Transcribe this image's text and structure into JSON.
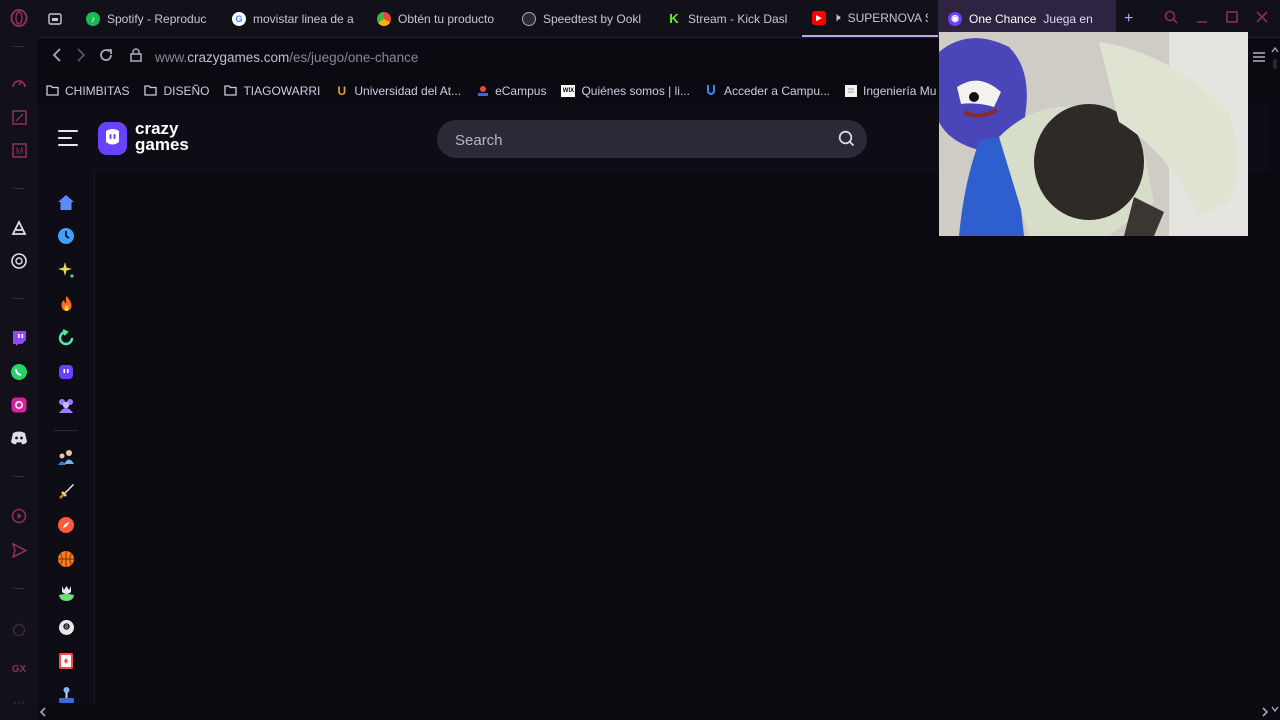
{
  "gx_rail": {
    "icons": [
      "opera-gx-logo-icon",
      "speed-dial-icon",
      "notes-icon",
      "mail-icon",
      "aria-icon",
      "chatgpt-icon",
      "twitch-icon",
      "whatsapp-icon",
      "instagram-icon",
      "discord-icon",
      "player-icon",
      "send-icon",
      "history-icon",
      "gx-label",
      "more-icon"
    ],
    "gx_label": "GX",
    "more_label": "···"
  },
  "tabs": [
    {
      "label": "Spotify - Reproduc",
      "favicon_color": "#1db954",
      "favicon_glyph": "♪"
    },
    {
      "label": "movistar linea de a",
      "favicon_color": "#ffffff",
      "favicon_glyph": "G"
    },
    {
      "label": "Obtén tu producto",
      "favicon_color": "#e8483e",
      "favicon_glyph": "●"
    },
    {
      "label": "Speedtest by Ookl",
      "favicon_color": "#444444",
      "favicon_glyph": "◔"
    },
    {
      "label": "Stream - Kick Dasl",
      "favicon_color": "#53fc18",
      "favicon_glyph": "K"
    },
    {
      "label": "SUPERNOVA S",
      "favicon_color": "#ff0000",
      "favicon_glyph": "▶"
    },
    {
      "label": "One Chance",
      "label2": "Juega en",
      "favicon_color": "#6842ff",
      "favicon_glyph": "◉"
    }
  ],
  "tab_add": "+",
  "address": {
    "url_prefix": "www.",
    "url_main": "crazygames.com",
    "url_path": "/es/juego/one-chance"
  },
  "bookmarks": [
    {
      "label": "CHIMBITAS",
      "icon": "folder-icon"
    },
    {
      "label": "DISEÑO",
      "icon": "folder-icon"
    },
    {
      "label": "TIAGOWARRI",
      "icon": "folder-icon"
    },
    {
      "label": "Universidad del At...",
      "icon": "university-icon"
    },
    {
      "label": "eCampus",
      "icon": "ecampus-icon"
    },
    {
      "label": "Quiénes somos | li...",
      "icon": "wix-icon"
    },
    {
      "label": "Acceder a Campu...",
      "icon": "campus-icon"
    },
    {
      "label": "Ingeniería Mu",
      "icon": "document-icon"
    }
  ],
  "site": {
    "logo_line1": "crazy",
    "logo_line2": "games",
    "search_placeholder": "Search"
  },
  "side_nav": [
    {
      "name": "home",
      "color": "#5b8cff"
    },
    {
      "name": "recent",
      "color": "#3ea0ff"
    },
    {
      "name": "new",
      "color": "#f2d45a"
    },
    {
      "name": "trending",
      "color": "#ff6a2a"
    },
    {
      "name": "updated",
      "color": "#4ef0a0"
    },
    {
      "name": "originals",
      "color": "#6842ff"
    },
    {
      "name": "multiplayer",
      "color": "#9b7bff"
    },
    {
      "name": "two-player",
      "color": "#6fb4ff"
    },
    {
      "name": "action",
      "color": "#ffd36a"
    },
    {
      "name": "adventure",
      "color": "#ff5a3c"
    },
    {
      "name": "basketball",
      "color": "#ff7a1a"
    },
    {
      "name": "beauty",
      "color": "#6ee07a"
    },
    {
      "name": "billiards",
      "color": "#e8e8e8"
    },
    {
      "name": "card",
      "color": "#ff4a4a"
    },
    {
      "name": "casual",
      "color": "#7ab8ff"
    }
  ]
}
